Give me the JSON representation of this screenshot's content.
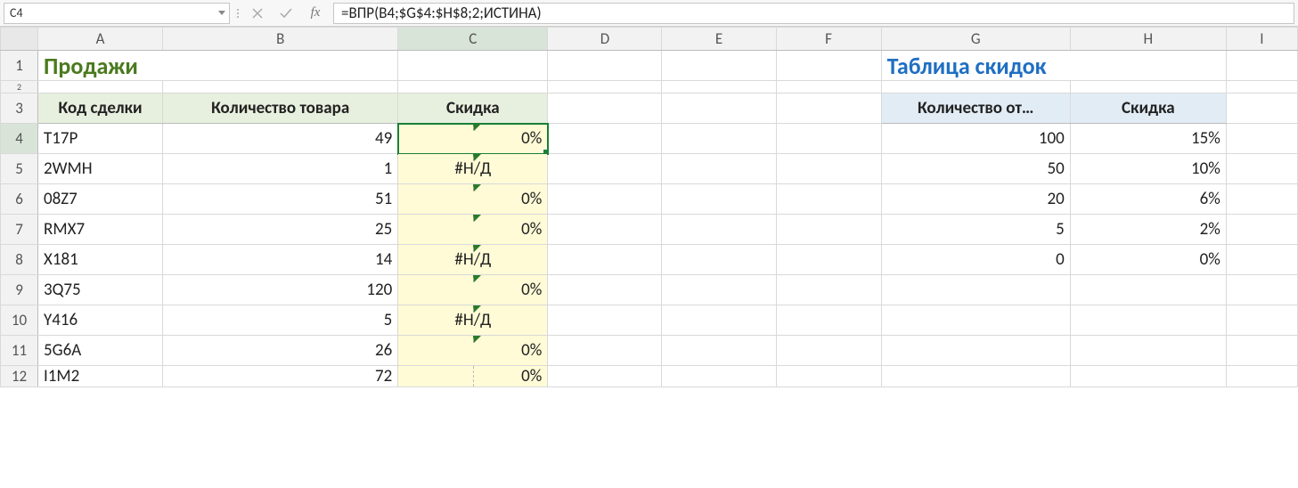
{
  "nameBox": "C4",
  "fxLabel": "fx",
  "formula": "=ВПР(B4;$G$4:$H$8;2;ИСТИНА)",
  "columns": [
    "A",
    "B",
    "C",
    "D",
    "E",
    "F",
    "G",
    "H",
    "I"
  ],
  "titles": {
    "sales": "Продажи",
    "discounts": "Таблица скидок"
  },
  "salesHeaders": {
    "code": "Код сделки",
    "qty": "Количество товара",
    "discount": "Скидка"
  },
  "discountHeaders": {
    "qtyFrom": "Количество от…",
    "discount": "Скидка"
  },
  "sales": [
    {
      "code": "T17P",
      "qty": "49",
      "discount": "0%",
      "err": false,
      "hl": true
    },
    {
      "code": "2WMH",
      "qty": "1",
      "discount": "#Н/Д",
      "err": true
    },
    {
      "code": "08Z7",
      "qty": "51",
      "discount": "0%",
      "err": false,
      "hl": true
    },
    {
      "code": "RMX7",
      "qty": "25",
      "discount": "0%",
      "err": false,
      "hl": true
    },
    {
      "code": "X181",
      "qty": "14",
      "discount": "#Н/Д",
      "err": true
    },
    {
      "code": "3Q75",
      "qty": "120",
      "discount": "0%",
      "err": false,
      "hl": true
    },
    {
      "code": "Y416",
      "qty": "5",
      "discount": "#Н/Д",
      "err": true
    },
    {
      "code": "5G6A",
      "qty": "26",
      "discount": "0%",
      "err": false,
      "hl": true
    },
    {
      "code": "I1M2",
      "qty": "72",
      "discount": "0%",
      "err": false
    }
  ],
  "discountTable": [
    {
      "from": "100",
      "disc": "15%"
    },
    {
      "from": "50",
      "disc": "10%"
    },
    {
      "from": "20",
      "disc": "6%"
    },
    {
      "from": "5",
      "disc": "2%"
    },
    {
      "from": "0",
      "disc": "0%"
    }
  ]
}
